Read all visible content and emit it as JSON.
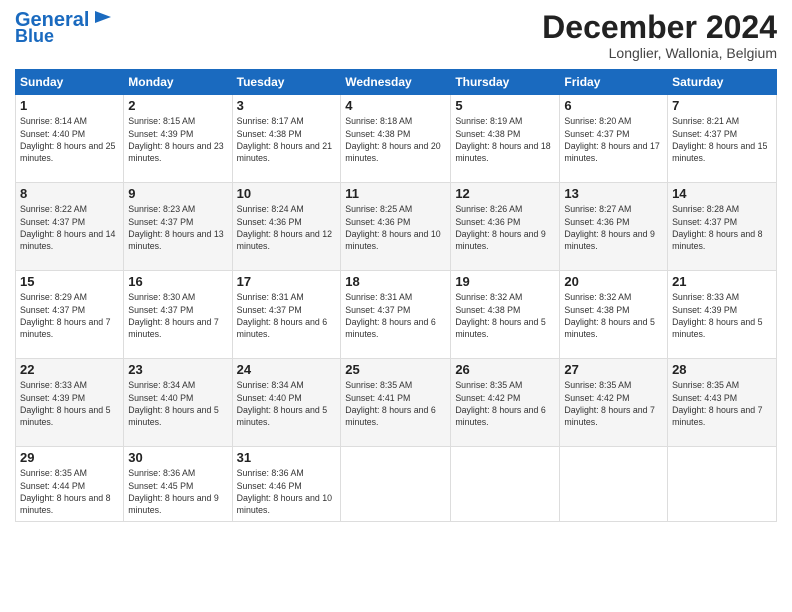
{
  "header": {
    "logo_line1": "General",
    "logo_line2": "Blue",
    "title": "December 2024",
    "location": "Longlier, Wallonia, Belgium"
  },
  "columns": [
    "Sunday",
    "Monday",
    "Tuesday",
    "Wednesday",
    "Thursday",
    "Friday",
    "Saturday"
  ],
  "weeks": [
    [
      {
        "day": "1",
        "sunrise": "Sunrise: 8:14 AM",
        "sunset": "Sunset: 4:40 PM",
        "daylight": "Daylight: 8 hours and 25 minutes."
      },
      {
        "day": "2",
        "sunrise": "Sunrise: 8:15 AM",
        "sunset": "Sunset: 4:39 PM",
        "daylight": "Daylight: 8 hours and 23 minutes."
      },
      {
        "day": "3",
        "sunrise": "Sunrise: 8:17 AM",
        "sunset": "Sunset: 4:38 PM",
        "daylight": "Daylight: 8 hours and 21 minutes."
      },
      {
        "day": "4",
        "sunrise": "Sunrise: 8:18 AM",
        "sunset": "Sunset: 4:38 PM",
        "daylight": "Daylight: 8 hours and 20 minutes."
      },
      {
        "day": "5",
        "sunrise": "Sunrise: 8:19 AM",
        "sunset": "Sunset: 4:38 PM",
        "daylight": "Daylight: 8 hours and 18 minutes."
      },
      {
        "day": "6",
        "sunrise": "Sunrise: 8:20 AM",
        "sunset": "Sunset: 4:37 PM",
        "daylight": "Daylight: 8 hours and 17 minutes."
      },
      {
        "day": "7",
        "sunrise": "Sunrise: 8:21 AM",
        "sunset": "Sunset: 4:37 PM",
        "daylight": "Daylight: 8 hours and 15 minutes."
      }
    ],
    [
      {
        "day": "8",
        "sunrise": "Sunrise: 8:22 AM",
        "sunset": "Sunset: 4:37 PM",
        "daylight": "Daylight: 8 hours and 14 minutes."
      },
      {
        "day": "9",
        "sunrise": "Sunrise: 8:23 AM",
        "sunset": "Sunset: 4:37 PM",
        "daylight": "Daylight: 8 hours and 13 minutes."
      },
      {
        "day": "10",
        "sunrise": "Sunrise: 8:24 AM",
        "sunset": "Sunset: 4:36 PM",
        "daylight": "Daylight: 8 hours and 12 minutes."
      },
      {
        "day": "11",
        "sunrise": "Sunrise: 8:25 AM",
        "sunset": "Sunset: 4:36 PM",
        "daylight": "Daylight: 8 hours and 10 minutes."
      },
      {
        "day": "12",
        "sunrise": "Sunrise: 8:26 AM",
        "sunset": "Sunset: 4:36 PM",
        "daylight": "Daylight: 8 hours and 9 minutes."
      },
      {
        "day": "13",
        "sunrise": "Sunrise: 8:27 AM",
        "sunset": "Sunset: 4:36 PM",
        "daylight": "Daylight: 8 hours and 9 minutes."
      },
      {
        "day": "14",
        "sunrise": "Sunrise: 8:28 AM",
        "sunset": "Sunset: 4:37 PM",
        "daylight": "Daylight: 8 hours and 8 minutes."
      }
    ],
    [
      {
        "day": "15",
        "sunrise": "Sunrise: 8:29 AM",
        "sunset": "Sunset: 4:37 PM",
        "daylight": "Daylight: 8 hours and 7 minutes."
      },
      {
        "day": "16",
        "sunrise": "Sunrise: 8:30 AM",
        "sunset": "Sunset: 4:37 PM",
        "daylight": "Daylight: 8 hours and 7 minutes."
      },
      {
        "day": "17",
        "sunrise": "Sunrise: 8:31 AM",
        "sunset": "Sunset: 4:37 PM",
        "daylight": "Daylight: 8 hours and 6 minutes."
      },
      {
        "day": "18",
        "sunrise": "Sunrise: 8:31 AM",
        "sunset": "Sunset: 4:37 PM",
        "daylight": "Daylight: 8 hours and 6 minutes."
      },
      {
        "day": "19",
        "sunrise": "Sunrise: 8:32 AM",
        "sunset": "Sunset: 4:38 PM",
        "daylight": "Daylight: 8 hours and 5 minutes."
      },
      {
        "day": "20",
        "sunrise": "Sunrise: 8:32 AM",
        "sunset": "Sunset: 4:38 PM",
        "daylight": "Daylight: 8 hours and 5 minutes."
      },
      {
        "day": "21",
        "sunrise": "Sunrise: 8:33 AM",
        "sunset": "Sunset: 4:39 PM",
        "daylight": "Daylight: 8 hours and 5 minutes."
      }
    ],
    [
      {
        "day": "22",
        "sunrise": "Sunrise: 8:33 AM",
        "sunset": "Sunset: 4:39 PM",
        "daylight": "Daylight: 8 hours and 5 minutes."
      },
      {
        "day": "23",
        "sunrise": "Sunrise: 8:34 AM",
        "sunset": "Sunset: 4:40 PM",
        "daylight": "Daylight: 8 hours and 5 minutes."
      },
      {
        "day": "24",
        "sunrise": "Sunrise: 8:34 AM",
        "sunset": "Sunset: 4:40 PM",
        "daylight": "Daylight: 8 hours and 5 minutes."
      },
      {
        "day": "25",
        "sunrise": "Sunrise: 8:35 AM",
        "sunset": "Sunset: 4:41 PM",
        "daylight": "Daylight: 8 hours and 6 minutes."
      },
      {
        "day": "26",
        "sunrise": "Sunrise: 8:35 AM",
        "sunset": "Sunset: 4:42 PM",
        "daylight": "Daylight: 8 hours and 6 minutes."
      },
      {
        "day": "27",
        "sunrise": "Sunrise: 8:35 AM",
        "sunset": "Sunset: 4:42 PM",
        "daylight": "Daylight: 8 hours and 7 minutes."
      },
      {
        "day": "28",
        "sunrise": "Sunrise: 8:35 AM",
        "sunset": "Sunset: 4:43 PM",
        "daylight": "Daylight: 8 hours and 7 minutes."
      }
    ],
    [
      {
        "day": "29",
        "sunrise": "Sunrise: 8:35 AM",
        "sunset": "Sunset: 4:44 PM",
        "daylight": "Daylight: 8 hours and 8 minutes."
      },
      {
        "day": "30",
        "sunrise": "Sunrise: 8:36 AM",
        "sunset": "Sunset: 4:45 PM",
        "daylight": "Daylight: 8 hours and 9 minutes."
      },
      {
        "day": "31",
        "sunrise": "Sunrise: 8:36 AM",
        "sunset": "Sunset: 4:46 PM",
        "daylight": "Daylight: 8 hours and 10 minutes."
      },
      null,
      null,
      null,
      null
    ]
  ]
}
